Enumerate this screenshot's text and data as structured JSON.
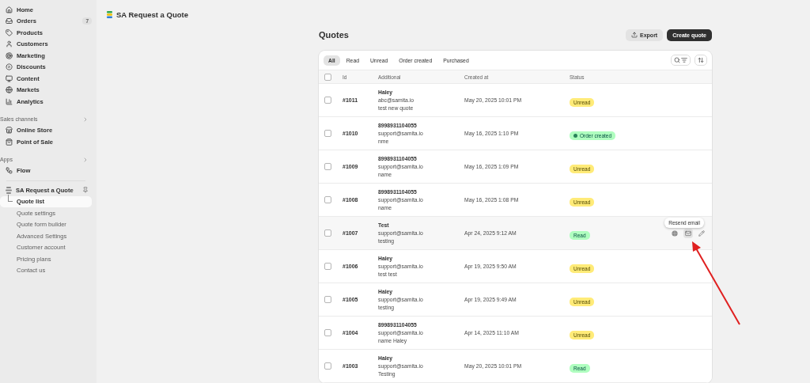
{
  "sidebar": {
    "items": [
      {
        "label": "Home"
      },
      {
        "label": "Orders",
        "badge": "7"
      },
      {
        "label": "Products"
      },
      {
        "label": "Customers"
      },
      {
        "label": "Marketing"
      },
      {
        "label": "Discounts"
      },
      {
        "label": "Content"
      },
      {
        "label": "Markets"
      },
      {
        "label": "Analytics"
      }
    ],
    "sections": [
      {
        "title": "Sales channels",
        "items": [
          {
            "label": "Online Store"
          },
          {
            "label": "Point of Sale"
          }
        ]
      },
      {
        "title": "Apps",
        "items": [
          {
            "label": "Flow"
          }
        ]
      }
    ],
    "app": {
      "label": "SA Request a Quote",
      "items": [
        {
          "label": "Quote list",
          "selected": true
        },
        {
          "label": "Quote settings",
          "selected": false
        },
        {
          "label": "Quote form builder",
          "selected": false
        },
        {
          "label": "Advanced Settings",
          "selected": false
        },
        {
          "label": "Customer account",
          "selected": false
        },
        {
          "label": "Pricing plans",
          "selected": false
        },
        {
          "label": "Contact us",
          "selected": false
        }
      ]
    }
  },
  "app_title": "SA Request a Quote",
  "page": {
    "title": "Quotes",
    "buttons": [
      {
        "label": "Export",
        "kind": "secondary"
      },
      {
        "label": "Create quote",
        "kind": "primary"
      }
    ]
  },
  "tabs": [
    {
      "label": "All",
      "selected": true
    },
    {
      "label": "Read",
      "selected": false
    },
    {
      "label": "Unread",
      "selected": false
    },
    {
      "label": "Order created",
      "selected": false
    },
    {
      "label": "Purchased",
      "selected": false
    }
  ],
  "table": {
    "select_all_checked": false,
    "columns": [
      "Id",
      "Additional",
      "Created at",
      "Status"
    ],
    "rows": [
      {
        "id": "#1011",
        "name": "Haley",
        "email": "abc@samita.io",
        "note": "test new quote",
        "created": "May 20, 2025 10:01 PM",
        "status": {
          "label": "Unread",
          "kind": "unread"
        },
        "hovered": false
      },
      {
        "id": "#1010",
        "name": "8998931104055",
        "email": "support@samita.io",
        "note": "nme",
        "created": "May 16, 2025 1:10 PM",
        "status": {
          "label": "Order created",
          "kind": "order_created"
        },
        "hovered": false
      },
      {
        "id": "#1009",
        "name": "8998931104055",
        "email": "support@samita.io",
        "note": "name",
        "created": "May 16, 2025 1:09 PM",
        "status": {
          "label": "Unread",
          "kind": "unread"
        },
        "hovered": false
      },
      {
        "id": "#1008",
        "name": "8998931104055",
        "email": "support@samita.io",
        "note": "name",
        "created": "May 16, 2025 1:08 PM",
        "status": {
          "label": "Unread",
          "kind": "unread"
        },
        "hovered": false
      },
      {
        "id": "#1007",
        "name": "Test",
        "email": "support@samita.io",
        "note": "testing",
        "created": "Apr 24, 2025 9:12 AM",
        "status": {
          "label": "Read",
          "kind": "read"
        },
        "hovered": true,
        "tooltip": "Resend email"
      },
      {
        "id": "#1006",
        "name": "Haley",
        "email": "support@samita.io",
        "note": "test test",
        "created": "Apr 19, 2025 9:50 AM",
        "status": {
          "label": "Unread",
          "kind": "unread"
        },
        "hovered": false
      },
      {
        "id": "#1005",
        "name": "Haley",
        "email": "support@samita.io",
        "note": "testing",
        "created": "Apr 19, 2025 9:49 AM",
        "status": {
          "label": "Unread",
          "kind": "unread"
        },
        "hovered": false
      },
      {
        "id": "#1004",
        "name": "8998931104055",
        "email": "support@samita.io",
        "note": "name Haley",
        "created": "Apr 14, 2025 11:10 AM",
        "status": {
          "label": "Unread",
          "kind": "unread"
        },
        "hovered": false
      },
      {
        "id": "#1003",
        "name": "Haley",
        "email": "support@samita.io",
        "note": "Testing",
        "created": "May 20, 2025 10:01 PM",
        "status": {
          "label": "Read",
          "kind": "read"
        },
        "hovered": false
      }
    ]
  }
}
